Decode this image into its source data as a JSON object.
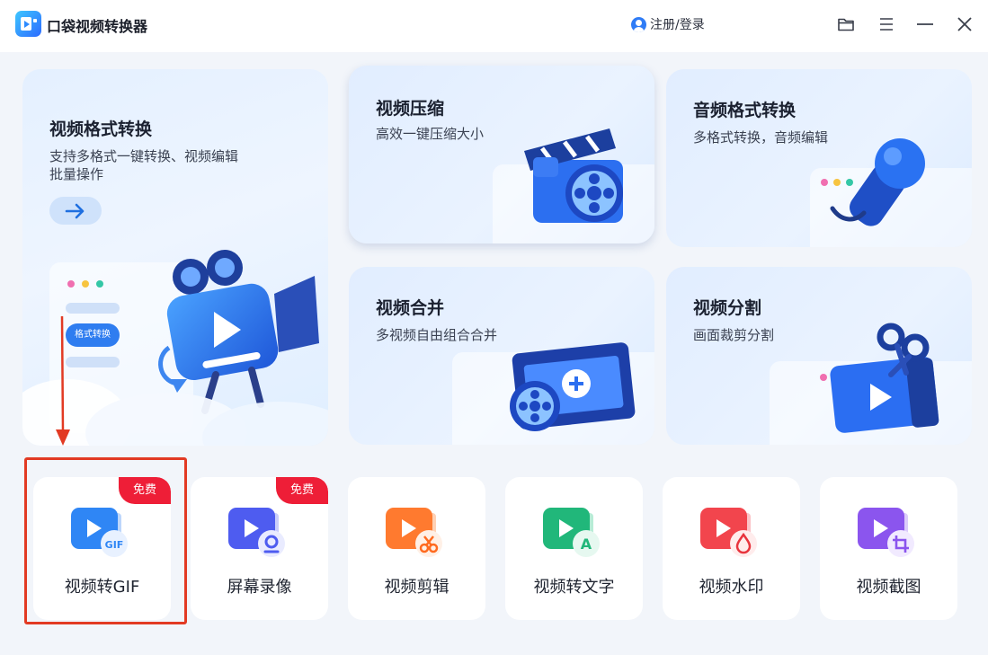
{
  "app": {
    "title": "口袋视频转换器",
    "login_label": "注册/登录"
  },
  "titlebar_icons": [
    "folder-icon",
    "menu-icon",
    "minimize-icon",
    "close-icon"
  ],
  "main_card": {
    "title": "视频格式转换",
    "subtitle_line1": "支持多格式一键转换、视频编辑",
    "subtitle_line2": "批量操作",
    "menu_chip": "格式转换"
  },
  "features": [
    {
      "title": "视频压缩",
      "subtitle": "高效一键压缩大小"
    },
    {
      "title": "音频格式转换",
      "subtitle": "多格式转换，音频编辑"
    },
    {
      "title": "视频合并",
      "subtitle": "多视频自由组合合并"
    },
    {
      "title": "视频分割",
      "subtitle": "画面裁剪分割"
    }
  ],
  "tools": [
    {
      "label": "视频转GIF",
      "badge": "免费",
      "icon": "gif-icon",
      "color": "#2f86f5"
    },
    {
      "label": "屏幕录像",
      "badge": "免费",
      "icon": "webcam-icon",
      "color": "#4e5cf0"
    },
    {
      "label": "视频剪辑",
      "icon": "scissors-icon",
      "color": "#ff7a2f"
    },
    {
      "label": "视频转文字",
      "icon": "text-a-icon",
      "color": "#21b77a"
    },
    {
      "label": "视频水印",
      "icon": "droplet-icon",
      "color": "#f2454d"
    },
    {
      "label": "视频截图",
      "icon": "crop-icon",
      "color": "#8b55ee"
    }
  ]
}
